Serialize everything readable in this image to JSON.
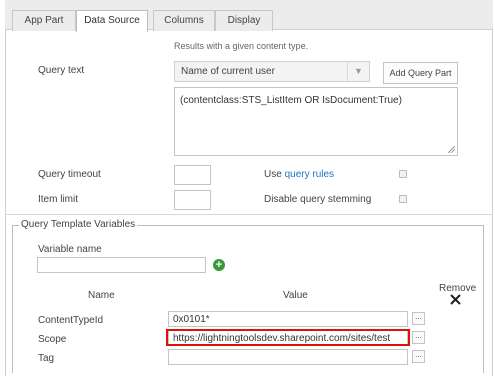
{
  "tabs": [
    {
      "label": "App Part",
      "active": false
    },
    {
      "label": "Data Source",
      "active": true
    },
    {
      "label": "Columns",
      "active": false
    },
    {
      "label": "Display",
      "active": false
    }
  ],
  "data_source": {
    "help_text": "Results with a given content type.",
    "query_text_label": "Query text",
    "query_part_select": "Name of current user",
    "add_query_part_label": "Add Query Part",
    "query_text_value": "(contentclass:STS_ListItem OR IsDocument:True)",
    "query_timeout_label": "Query timeout",
    "query_timeout_value": "",
    "item_limit_label": "Item limit",
    "item_limit_value": "",
    "use_label": "Use",
    "query_rules_link": "query rules",
    "use_query_rules_checked": false,
    "disable_stemming_label": "Disable query stemming",
    "disable_stemming_checked": false
  },
  "template_variables": {
    "legend": "Query Template Variables",
    "variable_name_label": "Variable name",
    "variable_name_value": "",
    "col_name": "Name",
    "col_value": "Value",
    "col_remove": "Remove",
    "ellipsis": "...",
    "rows": [
      {
        "name": "ContentTypeId",
        "value": "0x0101*"
      },
      {
        "name": "Scope",
        "value": "https://lightningtoolsdev.sharepoint.com/sites/test"
      },
      {
        "name": "Tag",
        "value": ""
      }
    ]
  },
  "icons": {
    "dropdown": "chevron-down-icon",
    "add": "plus-circle-icon",
    "remove": "close-icon"
  },
  "colors": {
    "link": "#1f73c9",
    "add_icon": "#3a9a3a",
    "highlight": "#e01010"
  }
}
